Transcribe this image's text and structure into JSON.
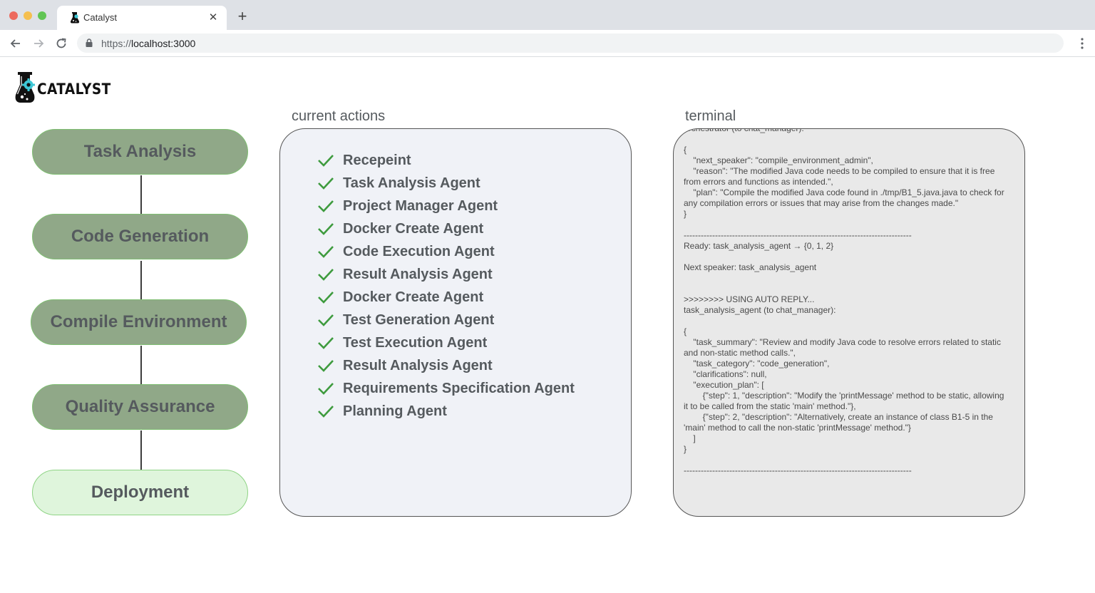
{
  "browser": {
    "tab_title": "Catalyst",
    "tab_close": "✕",
    "new_tab": "+",
    "url_scheme": "https://",
    "url_host": "localhost:3000"
  },
  "app": {
    "logo_text": "CATALYST",
    "colors": {
      "stage_complete": "#90a888",
      "stage_pending": "#dff5dc",
      "check": "#3e9b3e"
    }
  },
  "pipeline": {
    "stages": [
      {
        "label": "Task Analysis",
        "status": "complete"
      },
      {
        "label": "Code Generation",
        "status": "complete"
      },
      {
        "label": "Compile Environment",
        "status": "complete"
      },
      {
        "label": "Quality Assurance",
        "status": "complete"
      },
      {
        "label": "Deployment",
        "status": "pending"
      }
    ]
  },
  "actions": {
    "title": "current actions",
    "items": [
      "Recepeint",
      "Task Analysis Agent",
      "Project Manager Agent",
      "Docker Create Agent",
      "Code Execution Agent",
      "Result Analysis Agent",
      "Docker Create Agent",
      "Test Generation Agent",
      "Test Execution Agent",
      "Result Analysis Agent",
      "Requirements Specification Agent",
      "Planning Agent"
    ]
  },
  "terminal": {
    "title": "terminal",
    "text": "orchestrator (to chat_manager):\n\n{\n    \"next_speaker\": \"compile_environment_admin\",\n    \"reason\": \"The modified Java code needs to be compiled to ensure that it is free from errors and functions as intended.\",\n    \"plan\": \"Compile the modified Java code found in ./tmp/B1_5.java.java to check for any compilation errors or issues that may arise from the changes made.\"\n}\n\n--------------------------------------------------------------------------------\nReady: task_analysis_agent → {0, 1, 2}\n\nNext speaker: task_analysis_agent\n\n\n>>>>>>>> USING AUTO REPLY...\ntask_analysis_agent (to chat_manager):\n\n{\n    \"task_summary\": \"Review and modify Java code to resolve errors related to static and non-static method calls.\",\n    \"task_category\": \"code_generation\",\n    \"clarifications\": null,\n    \"execution_plan\": [\n        {\"step\": 1, \"description\": \"Modify the 'printMessage' method to be static, allowing it to be called from the static 'main' method.\"},\n        {\"step\": 2, \"description\": \"Alternatively, create an instance of class B1-5 in the 'main' method to call the non-static 'printMessage' method.\"}\n    ]\n}\n\n--------------------------------------------------------------------------------"
  }
}
